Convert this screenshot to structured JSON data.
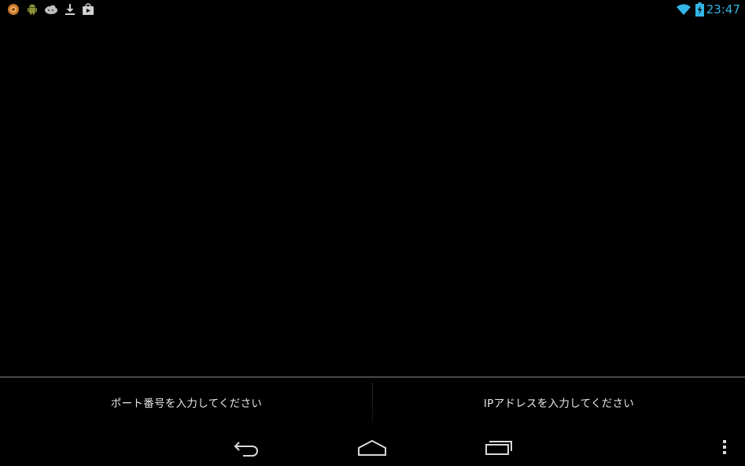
{
  "status_bar": {
    "clock": "23:47",
    "notification_icons": [
      "app-orange-icon",
      "android-icon",
      "cloud-icon",
      "download-icon",
      "play-store-icon"
    ],
    "wifi_icon": "wifi-icon",
    "battery_icon": "battery-charging-icon",
    "accent_color": "#33b5e5"
  },
  "inputs": {
    "port_placeholder": "ポート番号を入力してください",
    "ip_placeholder": "IPアドレスを入力してください"
  },
  "nav_bar": {
    "buttons": [
      "back-icon",
      "home-icon",
      "recents-icon",
      "overflow-menu-icon"
    ]
  }
}
